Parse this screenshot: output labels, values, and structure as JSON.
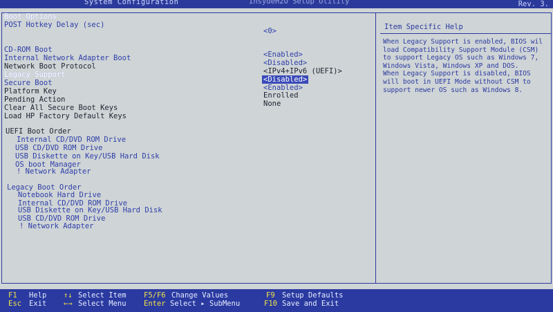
{
  "header": {
    "tab": "System Configuration",
    "utility": "InsydeH2O Setup Utility",
    "revision": "Rev. 3."
  },
  "settings": {
    "section_title": "Boot Options",
    "items": [
      {
        "label": "POST Hotkey Delay (sec)",
        "value": "<0>"
      },
      {
        "label": "CD-ROM Boot",
        "value": ""
      },
      {
        "label": "Internal Network Adapter Boot",
        "value": "<Enabled>"
      },
      {
        "label": "Network Boot Protocol",
        "value": "<Disabled>"
      },
      {
        "label": "Legacy Support",
        "value": "<IPv4+IPv6 (UEFI)>"
      },
      {
        "label": "Secure Boot",
        "value": "<Disabled>"
      },
      {
        "label": "Platform Key",
        "value": "<Enabled>"
      },
      {
        "label": "Pending Action",
        "value": "Enrolled"
      },
      {
        "label": "Clear All Secure Boot Keys",
        "value": "None"
      },
      {
        "label": "Load HP Factory Default Keys",
        "value": ""
      }
    ],
    "uefi_title": "UEFI Boot Order",
    "uefi_items": [
      "Internal CD/DVD ROM Drive",
      "USB CD/DVD ROM Drive",
      "USB Diskette on Key/USB Hard Disk",
      "OS boot Manager",
      "! Network Adapter"
    ],
    "legacy_title": "Legacy Boot Order",
    "legacy_items": [
      "Notebook Hard Drive",
      "Internal CD/DVD ROM Drive",
      "USB Diskette on Key/USB Hard Disk",
      "USB CD/DVD ROM Drive",
      "! Network Adapter"
    ]
  },
  "help": {
    "title": "Item Specific Help",
    "body": "When Legacy Support is enabled, BIOS wil\nload Compatibility Support Module (CSM)\nto support Legacy OS such as Windows 7,\nWindows Vista, Windows XP and DOS.\nWhen Legacy Support is disabled, BIOS\nwill boot in UEFI Mode without CSM to\nsupport newer OS such as Windows 8."
  },
  "footer": [
    {
      "key": "F1",
      "label": "Help"
    },
    {
      "key": "Esc",
      "label": "Exit"
    },
    {
      "key": "↑↓",
      "label": "Select Item"
    },
    {
      "key": "←→",
      "label": "Select Menu"
    },
    {
      "key": "F5/F6",
      "label": "Change Values"
    },
    {
      "key": "Enter",
      "label": "Select ▸ SubMenu"
    },
    {
      "key": "F9",
      "label": "Setup Defaults"
    },
    {
      "key": "F10",
      "label": "Save and Exit"
    }
  ],
  "colors": {
    "background": "#cfd4d6",
    "frame": "#2a3aa0",
    "text_blue": "#2d3ea8",
    "key_yellow": "#f1e34a"
  }
}
